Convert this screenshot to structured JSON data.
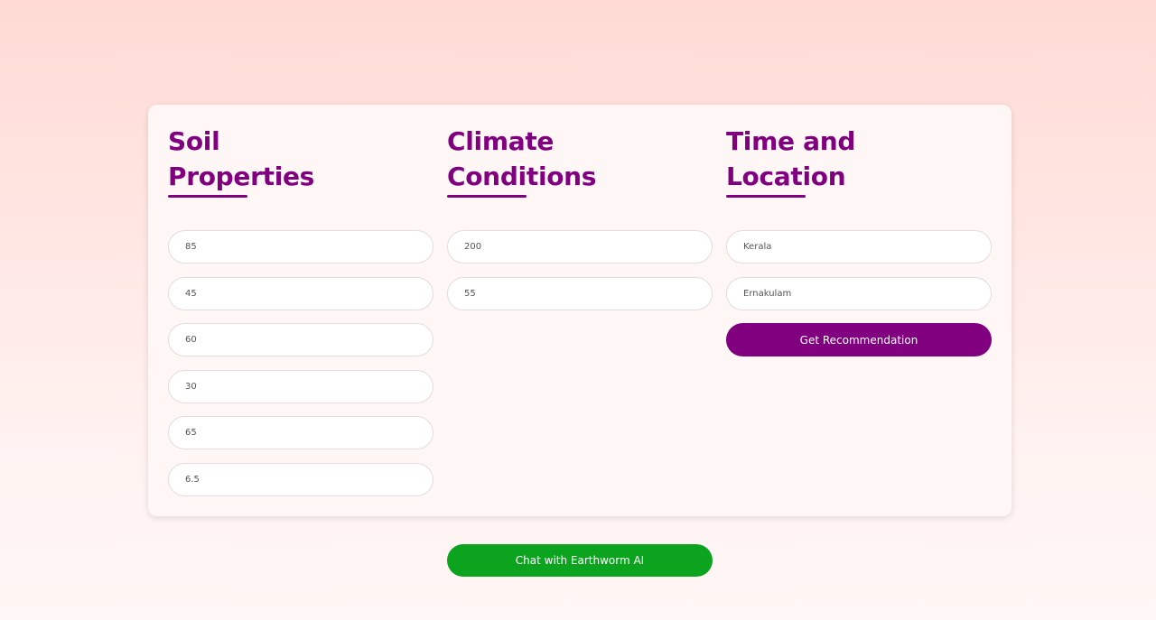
{
  "soil": {
    "heading_line1": "Soil",
    "heading_line2": "Properties",
    "fields": [
      "85",
      "45",
      "60",
      "30",
      "65",
      "6.5"
    ]
  },
  "climate": {
    "heading_line1": "Climate",
    "heading_line2": "Conditions",
    "fields": [
      "200",
      "55"
    ]
  },
  "location": {
    "heading_line1": "Time and",
    "heading_line2": "Location",
    "fields": [
      "Kerala",
      "Ernakulam"
    ],
    "button_label": "Get Recommendation"
  },
  "chat": {
    "button_label": "Chat with Earthworm AI"
  },
  "colors": {
    "accent": "#800080",
    "chat_button": "#0ca41f",
    "background_top": "#ffdad4",
    "card": "#fff7f6"
  }
}
